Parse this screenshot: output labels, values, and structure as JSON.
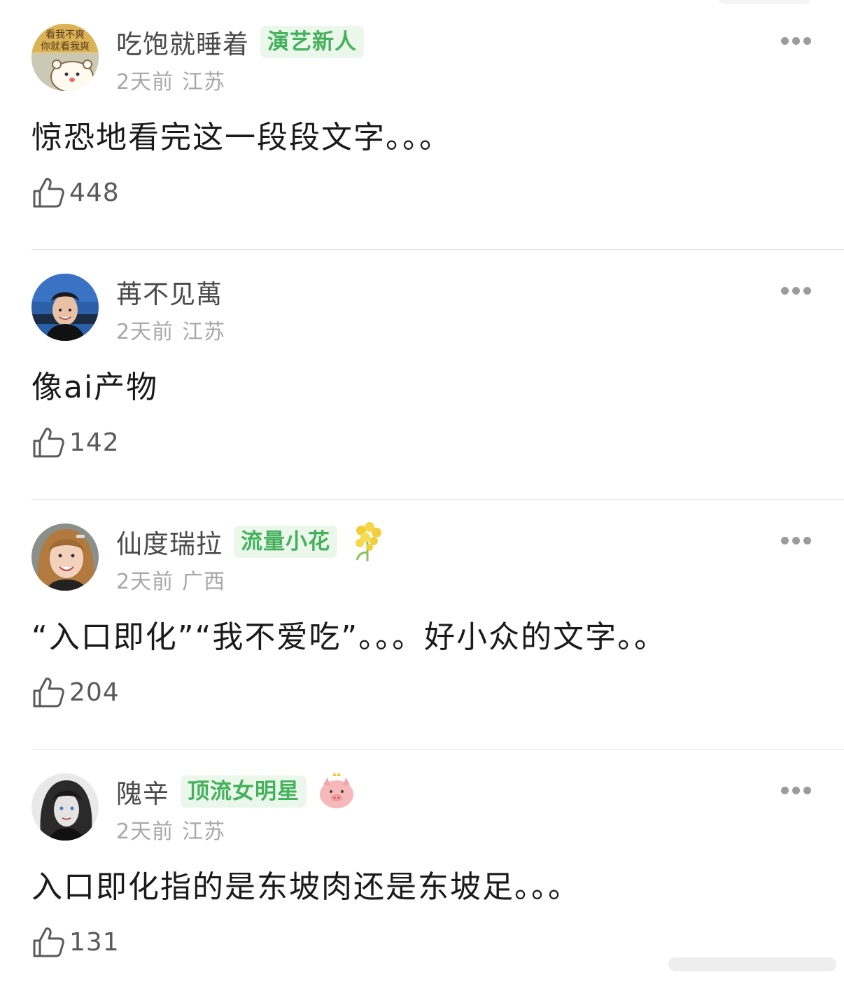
{
  "comments": [
    {
      "username": "吃饱就睡着",
      "badge": "演艺新人",
      "time": "2天前",
      "location": "江苏",
      "text": "惊恐地看完这一段段文字。。。",
      "likes": "448",
      "avatar_text_line1": "看我不爽",
      "avatar_text_line2": "你就看我爽"
    },
    {
      "username": "苒不见萬",
      "badge": "",
      "time": "2天前",
      "location": "江苏",
      "text": "像ai产物",
      "likes": "142"
    },
    {
      "username": "仙度瑞拉",
      "badge": "流量小花",
      "time": "2天前",
      "location": "广西",
      "text": "“入口即化”“我不爱吃”。。。好小众的文字。。",
      "likes": "204"
    },
    {
      "username": "隗辛",
      "badge": "顶流女明星",
      "time": "2天前",
      "location": "江苏",
      "text": "入口即化指的是东坡肉还是东坡足。。。",
      "likes": "131"
    }
  ],
  "colors": {
    "badge_text": "#44b15c",
    "badge_bg": "#eaf7ea",
    "username": "#4a4a4a",
    "meta": "#a8a8a8",
    "divider": "#e4e4e4"
  },
  "icons": {
    "like": "thumbs-up-outline-icon",
    "more": "more-dots-icon",
    "decoration_3": "rapeseed-flower-icon",
    "decoration_4": "pink-pig-icon"
  }
}
